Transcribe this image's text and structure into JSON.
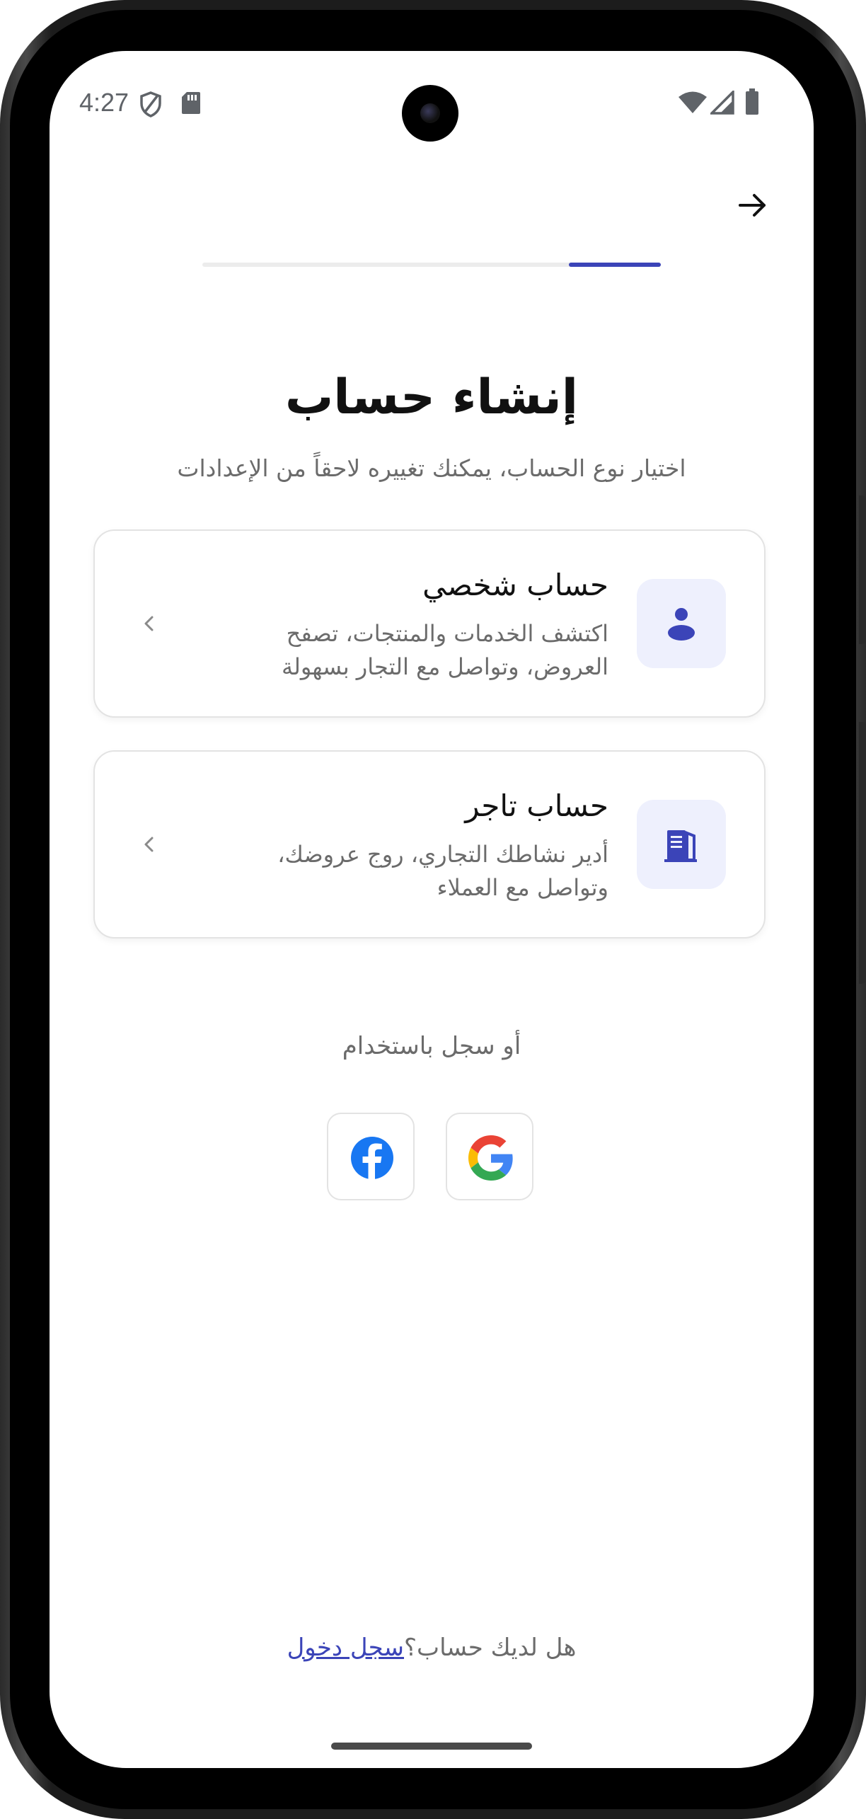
{
  "status_bar": {
    "time": "4:27"
  },
  "header": {
    "back_icon": "arrow-right-icon"
  },
  "progress": {
    "fraction": 0.2
  },
  "title": "إنشاء حساب",
  "subtitle": "اختيار نوع الحساب، يمكنك تغييره لاحقاً من الإعدادات",
  "accounts": [
    {
      "title": "حساب شخصي",
      "description": "اكتشف الخدمات والمنتجات، تصفح العروض، وتواصل مع التجار بسهولة",
      "icon": "person-icon"
    },
    {
      "title": "حساب تاجر",
      "description": "أدير نشاطك التجاري، روج عروضك، وتواصل مع العملاء",
      "icon": "building-icon"
    }
  ],
  "social": {
    "label": "أو سجل باستخدام",
    "providers": [
      "google-icon",
      "facebook-icon"
    ]
  },
  "footer": {
    "prompt": "هل لديك حساب؟",
    "link": "سجل دخول"
  },
  "colors": {
    "accent": "#3b44b8",
    "icon_bg": "#eef0fd",
    "border": "#e3e3e3",
    "muted_text": "#6b6b6b"
  }
}
